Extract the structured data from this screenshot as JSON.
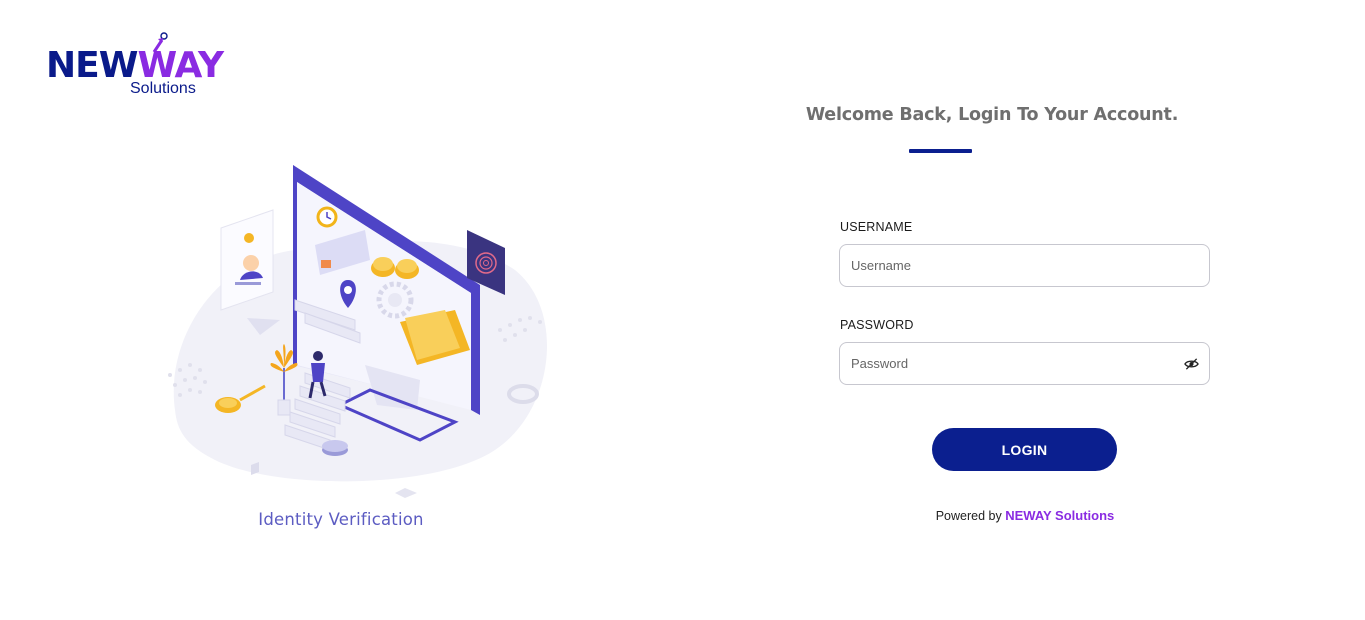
{
  "logo": {
    "word_new": "NEW",
    "word_way": "AY",
    "sub": "Solutions",
    "colors": {
      "primary": "#0a1a8a",
      "accent": "#8a2be2"
    }
  },
  "illustration": {
    "caption": "Identity Verification"
  },
  "form": {
    "welcome": "Welcome Back, Login To Your Account.",
    "username_label": "USERNAME",
    "username_placeholder": "Username",
    "username_value": "",
    "password_label": "PASSWORD",
    "password_placeholder": "Password",
    "password_value": "",
    "password_toggle_icon": "eye-slash-icon",
    "login_label": "LOGIN"
  },
  "footer": {
    "powered_prefix": "Powered by ",
    "powered_brand": "NEWAY Solutions"
  },
  "colors": {
    "brand_navy": "#0b1f8f",
    "brand_purple": "#8a2be2",
    "heading_gray": "#6f6f6f"
  }
}
